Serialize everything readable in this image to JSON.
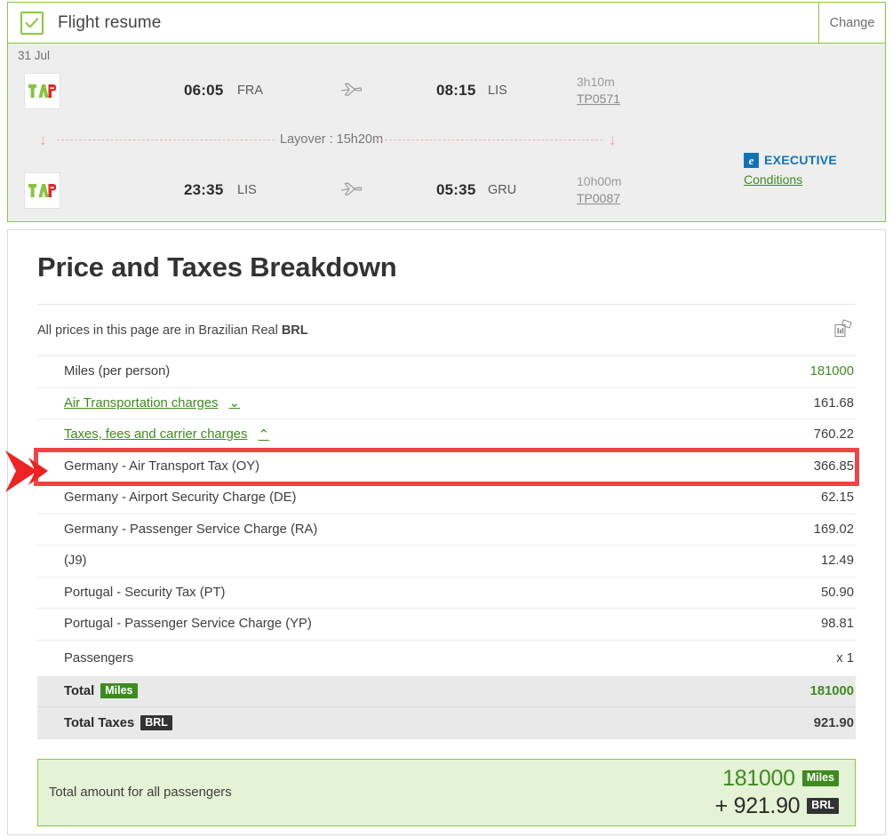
{
  "flight_resume": {
    "title": "Flight resume",
    "change_label": "Change",
    "checkbox_checked": true,
    "date": "31 Jul",
    "segments": [
      {
        "airline": "TAP",
        "departure_time": "06:05",
        "departure_code": "FRA",
        "arrival_time": "08:15",
        "arrival_code": "LIS",
        "duration": "3h10m",
        "flight_number": "TP0571"
      },
      {
        "airline": "TAP",
        "departure_time": "23:35",
        "departure_code": "LIS",
        "arrival_time": "05:35",
        "arrival_code": "GRU",
        "duration": "10h00m",
        "flight_number": "TP0087"
      }
    ],
    "layover_label": "Layover : 15h20m",
    "cabin": {
      "badge_letter": "e",
      "name": "EXECUTIVE",
      "conditions_label": "Conditions",
      "badge_color": "#1272B8"
    }
  },
  "breakdown": {
    "title": "Price and Taxes Breakdown",
    "currency_note_prefix": "All prices in this page are in Brazilian Real ",
    "currency_note_code": "BRL",
    "money_icon": "banknotes-icon",
    "rows": [
      {
        "label": "Miles (per person)",
        "value": "181000",
        "style": "green",
        "type": "plain"
      },
      {
        "label": "Air Transportation charges",
        "value": "161.68",
        "style": "normal",
        "type": "link",
        "chevron": "⌄"
      },
      {
        "label": "Taxes, fees and carrier charges",
        "value": "760.22",
        "style": "normal",
        "type": "link",
        "chevron": "⌃"
      }
    ],
    "tax_rows": [
      {
        "label": "Germany - Air Transport Tax (OY)",
        "value": "366.85",
        "highlighted": true
      },
      {
        "label": "Germany - Airport Security Charge (DE)",
        "value": "62.15",
        "highlighted": false
      },
      {
        "label": "Germany - Passenger Service Charge (RA)",
        "value": "169.02",
        "highlighted": false
      },
      {
        "label": "(J9)",
        "value": "12.49",
        "highlighted": false
      },
      {
        "label": "Portugal - Security Tax (PT)",
        "value": "50.90",
        "highlighted": false
      },
      {
        "label": "Portugal - Passenger Service Charge (YP)",
        "value": "98.81",
        "highlighted": false
      }
    ],
    "passengers": {
      "label": "Passengers",
      "value": "x 1"
    },
    "totals": [
      {
        "label": "Total",
        "badge": "Miles",
        "badge_kind": "miles",
        "value": "181000",
        "style": "green"
      },
      {
        "label": "Total Taxes",
        "badge": "BRL",
        "badge_kind": "brl",
        "value": "921.90",
        "style": "normal"
      }
    ],
    "grand_total": {
      "label": "Total amount for all passengers",
      "miles_value": "181000",
      "miles_badge": "Miles",
      "cash_value": "+ 921.90",
      "cash_badge": "BRL"
    }
  },
  "annotation": {
    "arrow_color": "#EE2222",
    "highlight_color": "#EE4444"
  },
  "colors": {
    "brand_green": "#8CC63E",
    "link_green": "#3E8B1F",
    "badge_dark": "#333333",
    "exec_blue": "#1272B8"
  }
}
